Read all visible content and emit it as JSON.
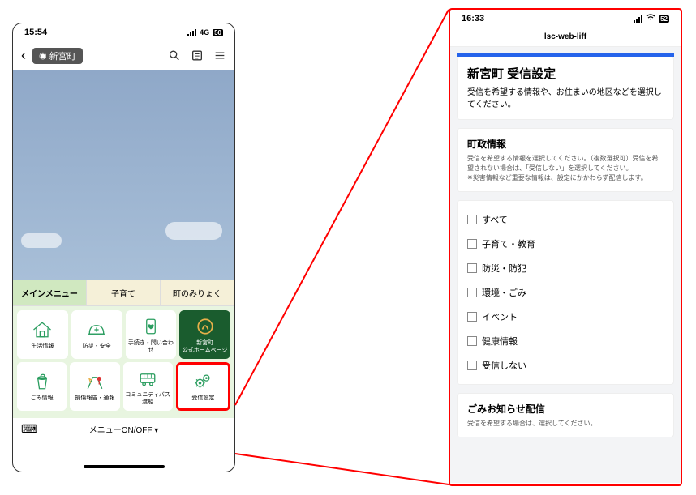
{
  "left": {
    "status": {
      "time": "15:54",
      "network": "4G"
    },
    "header": {
      "location": "新宮町"
    },
    "tabs": [
      "メインメニュー",
      "子育て",
      "町のみりょく"
    ],
    "grid": [
      {
        "label": "生活情報"
      },
      {
        "label": "防災・安全"
      },
      {
        "label": "手続き・問い合わせ"
      },
      {
        "label": "新宮町\n公式ホームページ"
      },
      {
        "label": "ごみ情報"
      },
      {
        "label": "損傷報告・通報"
      },
      {
        "label": "コミュニティバス\n渡船"
      },
      {
        "label": "受信設定"
      }
    ],
    "menu_toggle": "メニューON/OFF"
  },
  "right": {
    "status": {
      "time": "16:33"
    },
    "header_title": "lsc-web-liff",
    "main_title": "新宮町 受信設定",
    "main_desc": "受信を希望する情報や、お住まいの地区などを選択してください。",
    "section1": {
      "title": "町政情報",
      "desc": "受信を希望する情報を選択してください。（複数選択可）受信を希望されない場合は、「受信しない」を選択してください。\n※災害情報など重要な情報は、設定にかかわらず配信します。"
    },
    "checkboxes": [
      "すべて",
      "子育て・教育",
      "防災・防犯",
      "環境・ごみ",
      "イベント",
      "健康情報",
      "受信しない"
    ],
    "section2": {
      "title": "ごみお知らせ配信",
      "desc": "受信を希望する場合は、選択してください。"
    }
  }
}
